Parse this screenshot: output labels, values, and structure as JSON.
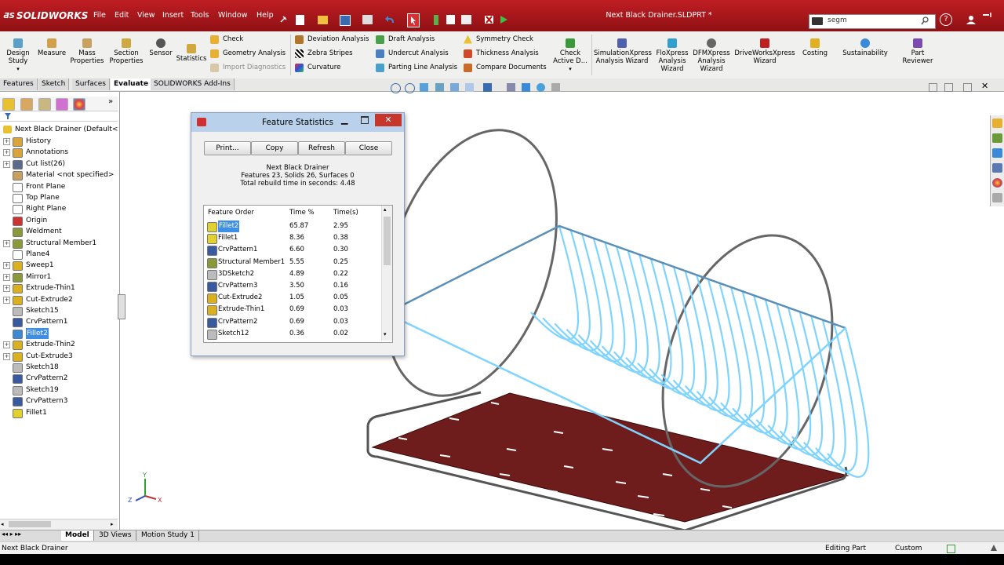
{
  "titlebar": {
    "app_name": "SOLIDWORKS",
    "menus": [
      "File",
      "Edit",
      "View",
      "Insert",
      "Tools",
      "Window",
      "Help"
    ],
    "document_title": "Next Black Drainer.SLDPRT *",
    "search_value": "segm",
    "help_glyph": "?"
  },
  "ribbon": {
    "design_study": "Design Study",
    "measure": "Measure",
    "mass_properties": "Mass Properties",
    "section_properties": "Section Properties",
    "sensor": "Sensor",
    "statistics": "Statistics",
    "check": "Check",
    "geometry_analysis": "Geometry Analysis",
    "import_diagnostics": "Import Diagnostics",
    "deviation_analysis": "Deviation Analysis",
    "zebra_stripes": "Zebra Stripes",
    "curvature": "Curvature",
    "draft_analysis": "Draft Analysis",
    "undercut_analysis": "Undercut Analysis",
    "parting_line_analysis": "Parting Line Analysis",
    "symmetry_check": "Symmetry Check",
    "thickness_analysis": "Thickness Analysis",
    "compare_documents": "Compare Documents",
    "check_active": "Check Active D...",
    "simulationxpress": "SimulationXpress Analysis Wizard",
    "floxpress": "FloXpress Analysis Wizard",
    "dfmxpress": "DFMXpress Analysis Wizard",
    "driveworksxpress": "DriveWorksXpress Wizard",
    "costing": "Costing",
    "sustainability": "Sustainability",
    "part_reviewer": "Part Reviewer"
  },
  "command_tabs": [
    "Features",
    "Sketch",
    "Surfaces",
    "Evaluate",
    "SOLIDWORKS Add-Ins"
  ],
  "feature_tree": {
    "root": "Next Black Drainer  (Default<As",
    "items": [
      {
        "label": "History",
        "expand": "+",
        "color": "#d9a53a"
      },
      {
        "label": "Annotations",
        "expand": "+",
        "color": "#d9a53a"
      },
      {
        "label": "Cut list(26)",
        "expand": "+",
        "color": "#5a6a8a"
      },
      {
        "label": "Material <not specified>",
        "expand": "",
        "color": "#c8a060"
      },
      {
        "label": "Front Plane",
        "expand": "",
        "color": "#ffffff"
      },
      {
        "label": "Top Plane",
        "expand": "",
        "color": "#ffffff"
      },
      {
        "label": "Right Plane",
        "expand": "",
        "color": "#ffffff"
      },
      {
        "label": "Origin",
        "expand": "",
        "color": "#cc3333"
      },
      {
        "label": "Weldment",
        "expand": "",
        "color": "#8a9a3a"
      },
      {
        "label": "Structural Member1",
        "expand": "+",
        "color": "#8a9a3a"
      },
      {
        "label": "Plane4",
        "expand": "",
        "color": "#ffffff"
      },
      {
        "label": "Sweep1",
        "expand": "+",
        "color": "#d9b020"
      },
      {
        "label": "Mirror1",
        "expand": "+",
        "color": "#8a9a3a"
      },
      {
        "label": "Extrude-Thin1",
        "expand": "+",
        "color": "#d9b020"
      },
      {
        "label": "Cut-Extrude2",
        "expand": "+",
        "color": "#d9b020"
      },
      {
        "label": "Sketch15",
        "expand": "",
        "color": "#bbbbbb"
      },
      {
        "label": "CrvPattern1",
        "expand": "",
        "color": "#3a5aa0"
      },
      {
        "label": "Fillet2",
        "expand": "",
        "color": "#3a8ad8",
        "selected": true
      },
      {
        "label": "Extrude-Thin2",
        "expand": "+",
        "color": "#d9b020"
      },
      {
        "label": "Cut-Extrude3",
        "expand": "+",
        "color": "#d9b020"
      },
      {
        "label": "Sketch18",
        "expand": "",
        "color": "#bbbbbb"
      },
      {
        "label": "CrvPattern2",
        "expand": "",
        "color": "#3a5aa0"
      },
      {
        "label": "Sketch19",
        "expand": "",
        "color": "#bbbbbb"
      },
      {
        "label": "CrvPattern3",
        "expand": "",
        "color": "#3a5aa0"
      },
      {
        "label": "Fillet1",
        "expand": "",
        "color": "#e0d030"
      }
    ]
  },
  "dialog": {
    "title": "Feature Statistics",
    "buttons": {
      "print": "Print...",
      "copy": "Copy",
      "refresh": "Refresh",
      "close": "Close"
    },
    "summary": {
      "name": "Next Black Drainer",
      "counts": "Features 23, Solids 26, Surfaces 0",
      "rebuild": "Total rebuild time in seconds: 4.48"
    },
    "columns": [
      "Feature Order",
      "Time %",
      "Time(s)"
    ],
    "rows": [
      {
        "name": "Fillet2",
        "pct": "65.87",
        "time": "2.95",
        "color": "#e0d030"
      },
      {
        "name": "Fillet1",
        "pct": "8.36",
        "time": "0.38",
        "color": "#e0d030"
      },
      {
        "name": "CrvPattern1",
        "pct": "6.60",
        "time": "0.30",
        "color": "#3a5aa0"
      },
      {
        "name": "Structural Member1",
        "pct": "5.55",
        "time": "0.25",
        "color": "#8a9a3a"
      },
      {
        "name": "3DSketch2",
        "pct": "4.89",
        "time": "0.22",
        "color": "#bbbbbb"
      },
      {
        "name": "CrvPattern3",
        "pct": "3.50",
        "time": "0.16",
        "color": "#3a5aa0"
      },
      {
        "name": "Cut-Extrude2",
        "pct": "1.05",
        "time": "0.05",
        "color": "#d9b020"
      },
      {
        "name": "Extrude-Thin1",
        "pct": "0.69",
        "time": "0.03",
        "color": "#d9b020"
      },
      {
        "name": "CrvPattern2",
        "pct": "0.69",
        "time": "0.03",
        "color": "#3a5aa0"
      },
      {
        "name": "Sketch12",
        "pct": "0.36",
        "time": "0.02",
        "color": "#bbbbbb"
      }
    ]
  },
  "bottom_tabs": [
    "Model",
    "3D Views",
    "Motion Study 1"
  ],
  "statusbar": {
    "left": "Next Black Drainer",
    "editing": "Editing Part",
    "units": "Custom"
  },
  "triad": {
    "x": "X",
    "y": "Y",
    "z": "Z"
  },
  "colors": {
    "brand_red": "#bf1e23",
    "highlight_blue": "#3f8ee5",
    "wire_selected": "#7fd4ff",
    "tray_maroon": "#6e1c1c"
  }
}
